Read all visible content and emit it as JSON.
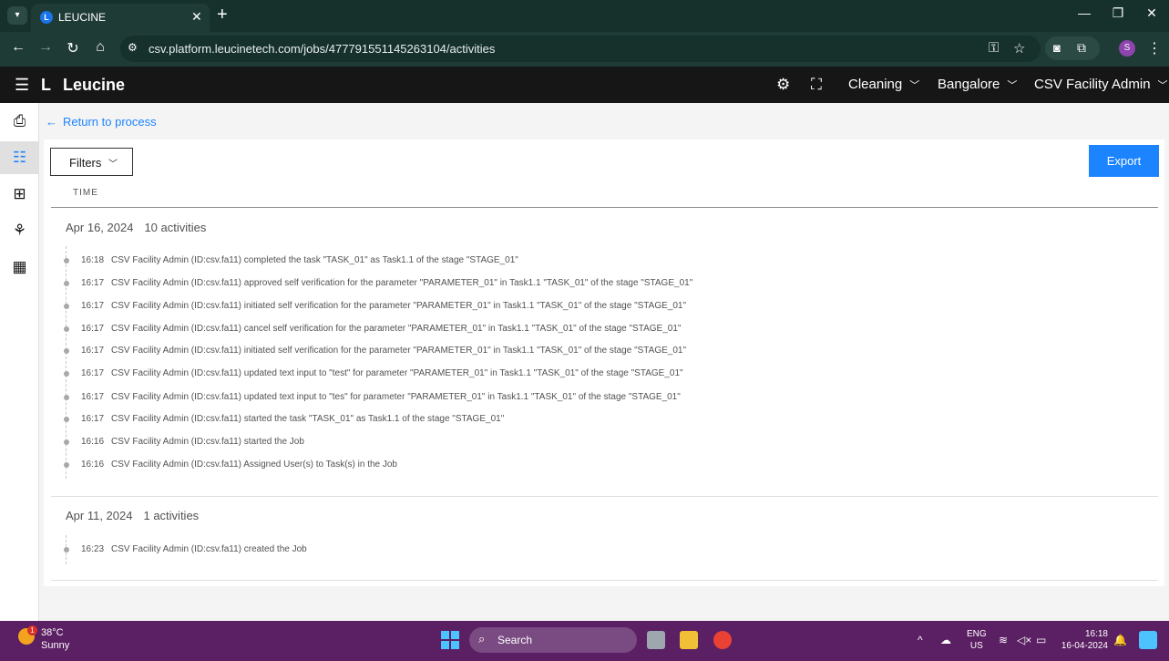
{
  "browser": {
    "tab_title": "LEUCINE",
    "tab_favicon": "L",
    "url": "csv.platform.leucinetech.com/jobs/477791551145263104/activities",
    "profile_initial": "S"
  },
  "app": {
    "logo_mark": "L",
    "logo_text": "Leucine",
    "use_case": "Cleaning",
    "facility": "Bangalore",
    "user": "CSV Facility Admin"
  },
  "page": {
    "return_link": "Return to process",
    "filters_label": "Filters",
    "export_label": "Export",
    "time_header": "TIME"
  },
  "groups": [
    {
      "date": "Apr 16, 2024",
      "count": "10 activities",
      "entries": [
        {
          "time": "16:18",
          "text": "CSV Facility Admin (ID:csv.fa11) completed the task \"TASK_01\" as Task1.1 of the stage \"STAGE_01\""
        },
        {
          "time": "16:17",
          "text": "CSV Facility Admin (ID:csv.fa11) approved self verification for the parameter \"PARAMETER_01\" in Task1.1 \"TASK_01\" of the stage \"STAGE_01\""
        },
        {
          "time": "16:17",
          "text": "CSV Facility Admin (ID:csv.fa11) initiated self verification for the parameter \"PARAMETER_01\" in Task1.1 \"TASK_01\" of the stage \"STAGE_01\""
        },
        {
          "time": "16:17",
          "text": "CSV Facility Admin (ID:csv.fa11) cancel self verification for the parameter \"PARAMETER_01\" in Task1.1 \"TASK_01\" of the stage \"STAGE_01\""
        },
        {
          "time": "16:17",
          "text": "CSV Facility Admin (ID:csv.fa11) initiated self verification for the parameter \"PARAMETER_01\" in Task1.1 \"TASK_01\" of the stage \"STAGE_01\""
        },
        {
          "time": "16:17",
          "text": "CSV Facility Admin (ID:csv.fa11) updated text input to \"test\" for parameter \"PARAMETER_01\" in Task1.1 \"TASK_01\" of the stage \"STAGE_01\""
        },
        {
          "time": "16:17",
          "text": "CSV Facility Admin (ID:csv.fa11) updated text input to \"tes\" for parameter \"PARAMETER_01\" in Task1.1 \"TASK_01\" of the stage \"STAGE_01\""
        },
        {
          "time": "16:17",
          "text": "CSV Facility Admin (ID:csv.fa11) started the task \"TASK_01\" as Task1.1 of the stage \"STAGE_01\""
        },
        {
          "time": "16:16",
          "text": "CSV Facility Admin (ID:csv.fa11) started the Job"
        },
        {
          "time": "16:16",
          "text": "CSV Facility Admin (ID:csv.fa11) Assigned User(s) to Task(s) in the Job"
        }
      ]
    },
    {
      "date": "Apr 11, 2024",
      "count": "1 activities",
      "entries": [
        {
          "time": "16:23",
          "text": "CSV Facility Admin (ID:csv.fa11) created the Job"
        }
      ]
    }
  ],
  "taskbar": {
    "weather_badge": "1",
    "temperature": "38°C",
    "weather": "Sunny",
    "search_label": "Search",
    "lang_line1": "ENG",
    "lang_line2": "US",
    "time": "16:18",
    "date": "16-04-2024"
  },
  "icons": {
    "tab_menu": "chevron-down-icon",
    "settings": "gear-icon",
    "scan": "scan-icon",
    "rail": [
      "inbox-icon",
      "checklist-icon",
      "process-icon",
      "hierarchy-icon",
      "report-icon"
    ]
  },
  "colors": {
    "accent": "#1d84ff",
    "header_bg": "#161616",
    "chrome_bg": "#1f3b36",
    "taskbar_bg": "#5b1f63"
  }
}
